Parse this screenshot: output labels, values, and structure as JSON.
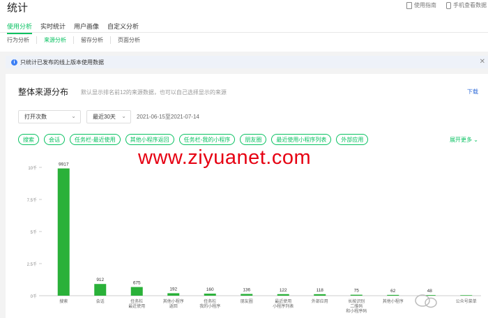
{
  "page": {
    "title": "统计",
    "top_links": [
      "使用指南",
      "手机查看数据"
    ]
  },
  "tabs": [
    {
      "label": "使用分析",
      "active": true
    },
    {
      "label": "实时统计",
      "active": false
    },
    {
      "label": "用户画像",
      "active": false
    },
    {
      "label": "自定义分析",
      "active": false
    }
  ],
  "subtabs": [
    {
      "label": "行为分析",
      "active": false
    },
    {
      "label": "来源分析",
      "active": true
    },
    {
      "label": "留存分析",
      "active": false
    },
    {
      "label": "页面分析",
      "active": false
    }
  ],
  "notice": {
    "text": "只统计已发布的线上版本使用数据"
  },
  "card": {
    "title": "整体来源分布",
    "desc": "默认显示排名前12的来源数据，也可以自己选择显示的来源",
    "download": "下载",
    "metric_select": "打开次数",
    "period_select": "最近30天",
    "date_range": "2021-06-15至2021-07-14",
    "chips": [
      "搜索",
      "会话",
      "任务栏-最近使用",
      "其他小程序返回",
      "任务栏-我的小程序",
      "朋友圈",
      "最近使用小程序列表",
      "外部应用"
    ],
    "expand": "展开更多"
  },
  "watermark": {
    "text": "www.ziyuanet.com"
  },
  "colors": {
    "accent": "#07c160",
    "bar": "#2ab139",
    "watermark": "#e60012",
    "link": "#2f6bd8"
  },
  "chart_data": {
    "type": "bar",
    "categories": [
      [
        "搜索"
      ],
      [
        "会话"
      ],
      [
        "任务栏",
        "最近使用"
      ],
      [
        "其他小程序",
        "返回"
      ],
      [
        "任务栏",
        "我的小程序"
      ],
      [
        "朋友圈"
      ],
      [
        "最近使用",
        "小程序列表"
      ],
      [
        "外部应用"
      ],
      [
        "长按识别",
        "二维码",
        "和小程序码"
      ],
      [
        "其他小程序"
      ],
      [
        ""
      ],
      [
        "公众号菜单"
      ]
    ],
    "values": [
      9917,
      912,
      675,
      192,
      160,
      136,
      122,
      118,
      75,
      62,
      48,
      40
    ],
    "data_labels": [
      "9917",
      "912",
      "675",
      "192",
      "160",
      "136",
      "122",
      "118",
      "75",
      "62",
      "48",
      ""
    ],
    "yticks": [
      0,
      2500,
      5000,
      7500,
      10000
    ],
    "ytick_labels": [
      "0千",
      "2.5千",
      "5千",
      "7.5千",
      "10千"
    ],
    "ylim": [
      0,
      10000
    ],
    "grid": false,
    "legend": "none"
  }
}
